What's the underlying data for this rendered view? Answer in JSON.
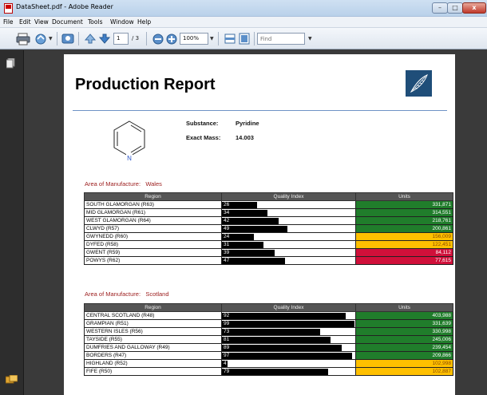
{
  "window": {
    "title": "DataSheet.pdf - Adobe Reader",
    "min": "–",
    "max": "□",
    "close": "x"
  },
  "menu": [
    "File",
    "Edit",
    "View",
    "Document",
    "Tools",
    "Window",
    "Help"
  ],
  "toolbar": {
    "page_current": "1",
    "page_total": "/ 3",
    "zoom": "100%",
    "find_placeholder": "Find"
  },
  "document": {
    "title": "Production Report",
    "substance_label": "Substance:",
    "substance_value": "Pyridine",
    "mass_label": "Exact Mass:",
    "mass_value": "14.003",
    "molecule_atom": "N"
  },
  "headers": {
    "region": "Region",
    "quality": "Quality Index",
    "units": "Units"
  },
  "sections": [
    {
      "area_label": "Area of Manufacture:",
      "area_value": "Wales",
      "rows": [
        {
          "region": "SOUTH GLAMORGAN (R63)",
          "quality": 26,
          "units": "331,871",
          "status": "green"
        },
        {
          "region": "MID GLAMORGAN (R61)",
          "quality": 34,
          "units": "314,551",
          "status": "green"
        },
        {
          "region": "WEST GLAMORGAN (R64)",
          "quality": 42,
          "units": "218,761",
          "status": "green"
        },
        {
          "region": "CLWYD (R57)",
          "quality": 49,
          "units": "200,861",
          "status": "green"
        },
        {
          "region": "GWYNEDD (R60)",
          "quality": 24,
          "units": "156,009",
          "status": "yellow"
        },
        {
          "region": "DYFED (R58)",
          "quality": 31,
          "units": "122,451",
          "status": "yellow"
        },
        {
          "region": "GWENT (R59)",
          "quality": 39,
          "units": "84,112",
          "status": "red"
        },
        {
          "region": "POWYS (R62)",
          "quality": 47,
          "units": "77,615",
          "status": "red"
        }
      ]
    },
    {
      "area_label": "Area of Manufacture:",
      "area_value": "Scotland",
      "rows": [
        {
          "region": "CENTRAL SCOTLAND (R48)",
          "quality": 92,
          "units": "403,988",
          "status": "green"
        },
        {
          "region": "GRAMPIAN (R51)",
          "quality": 99,
          "units": "331,639",
          "status": "green"
        },
        {
          "region": "WESTERN ISLES (R56)",
          "quality": 73,
          "units": "330,998",
          "status": "green"
        },
        {
          "region": "TAYSIDE (R55)",
          "quality": 81,
          "units": "245,006",
          "status": "green"
        },
        {
          "region": "DUMFRIES AND GALLOWAY (R49)",
          "quality": 89,
          "units": "239,454",
          "status": "green"
        },
        {
          "region": "BORDERS (R47)",
          "quality": 97,
          "units": "209,866",
          "status": "green"
        },
        {
          "region": "HIGHLAND (R52)",
          "quality": 4,
          "units": "102,998",
          "status": "yellow"
        },
        {
          "region": "FIFE (R50)",
          "quality": 79,
          "units": "102,887",
          "status": "yellow"
        }
      ]
    }
  ],
  "colors": {
    "green": "#207d2b",
    "yellow": "#ffc000",
    "red": "#d0103a",
    "accent": "#1f4e79"
  }
}
